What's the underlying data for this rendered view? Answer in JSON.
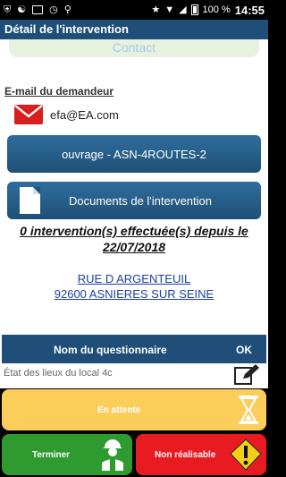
{
  "status_bar": {
    "battery_percent": "100 %",
    "time": "14:55"
  },
  "header": {
    "title": "Détail de l'intervention"
  },
  "main": {
    "contact_label": "Contact",
    "email_heading": "E-mail du demandeur",
    "email_value": "efa@EA.com",
    "ouvrage_button": "ouvrage - ASN-4ROUTES-2",
    "documents_button": "Documents de l'intervention",
    "interventions_count": "0 intervention(s) effectuée(s) depuis le 22/07/2018",
    "address_line1": "RUE D ARGENTEUIL",
    "address_line2": "92600 ASNIERES SUR SEINE"
  },
  "questionnaire": {
    "col_name": "Nom du questionnaire",
    "col_ok": "OK",
    "rows": [
      {
        "label": "État des lieux du local 4c"
      }
    ]
  },
  "actions": {
    "waiting": "En attente",
    "finish": "Terminer",
    "impossible": "Non réalisable"
  },
  "colors": {
    "title_bar": "#1f4e79",
    "primary_button": "#1e5078",
    "waiting": "#fbcd5a",
    "finish": "#2f9a2f",
    "impossible": "#e81b23",
    "envelope": "#d81e1e"
  }
}
